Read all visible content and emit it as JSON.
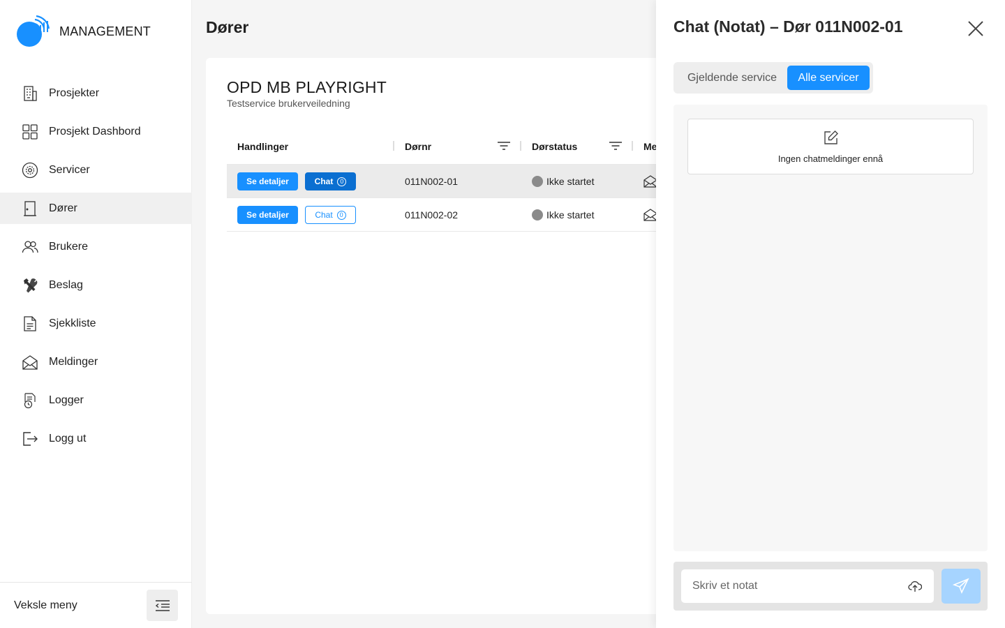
{
  "brand": {
    "name": "MANAGEMENT",
    "accent": "#1890ff"
  },
  "sidebar": {
    "items": [
      {
        "label": "Prosjekter",
        "icon": "building-icon"
      },
      {
        "label": "Prosjekt Dashbord",
        "icon": "dashboard-icon"
      },
      {
        "label": "Servicer",
        "icon": "service-gear-icon"
      },
      {
        "label": "Dører",
        "icon": "door-icon",
        "active": true
      },
      {
        "label": "Brukere",
        "icon": "users-icon"
      },
      {
        "label": "Beslag",
        "icon": "tools-icon"
      },
      {
        "label": "Sjekkliste",
        "icon": "checklist-icon"
      },
      {
        "label": "Meldinger",
        "icon": "envelope-icon"
      },
      {
        "label": "Logger",
        "icon": "log-icon"
      },
      {
        "label": "Logg ut",
        "icon": "logout-icon"
      }
    ],
    "footer_label": "Veksle meny"
  },
  "main": {
    "title": "Dører",
    "project": {
      "name": "OPD MB PLAYRIGHT",
      "subtitle": "Testservice brukerveiledning"
    },
    "table": {
      "headers": [
        "Handlinger",
        "Dørnr",
        "Dørstatus",
        "Me"
      ],
      "rows": [
        {
          "details_label": "Se detaljer",
          "chat_label": "Chat",
          "chat_count": "0",
          "door_no": "011N002-01",
          "status": "Ikke startet",
          "selected": true
        },
        {
          "details_label": "Se detaljer",
          "chat_label": "Chat",
          "chat_count": "0",
          "door_no": "011N002-02",
          "status": "Ikke startet",
          "selected": false
        }
      ]
    }
  },
  "panel": {
    "title": "Chat (Notat) – Dør 011N002-01",
    "tabs": [
      {
        "label": "Gjeldende service",
        "active": false
      },
      {
        "label": "Alle servicer",
        "active": true
      }
    ],
    "empty_text": "Ingen chatmeldinger ennå",
    "input_placeholder": "Skriv et notat"
  }
}
